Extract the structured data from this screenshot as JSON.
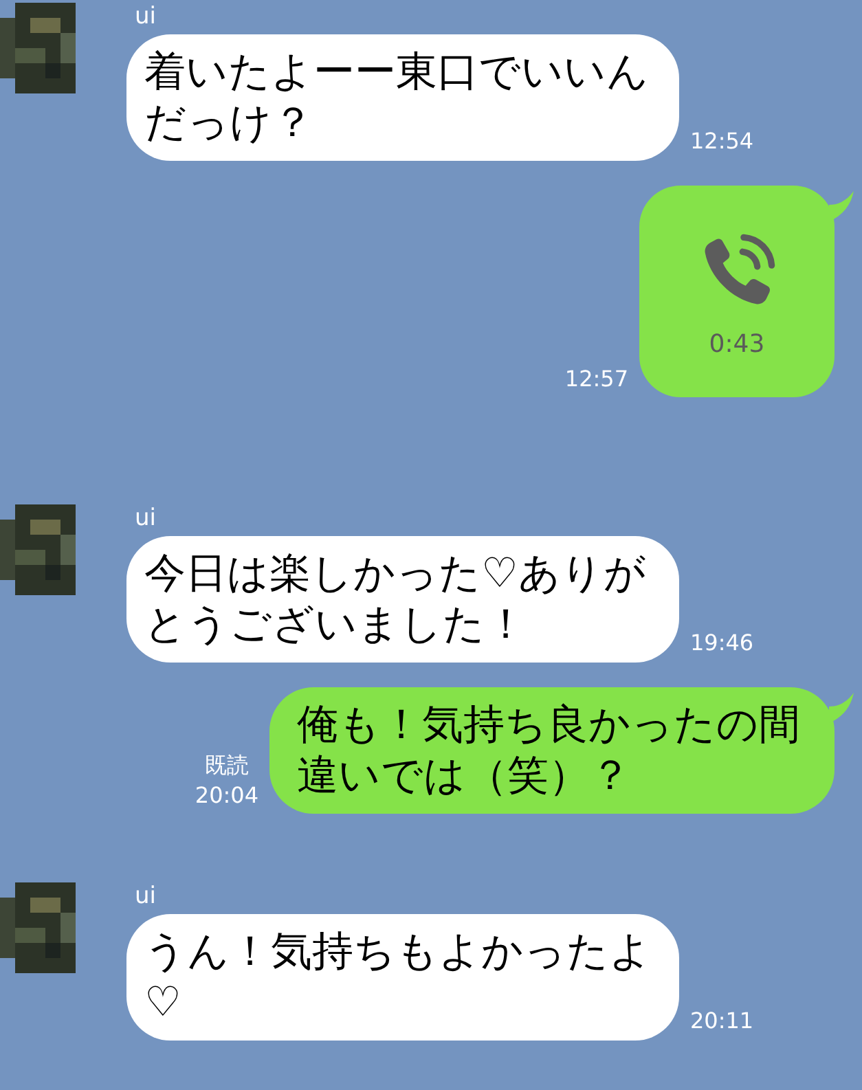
{
  "messages": [
    {
      "kind": "received",
      "sender": "ui",
      "text": "着いたよーー東口でいいんだっけ？",
      "time": "12:54"
    },
    {
      "kind": "call",
      "duration": "0:43",
      "time": "12:57"
    },
    {
      "kind": "received",
      "sender": "ui",
      "text": "今日は楽しかった♡ありがとうございました！",
      "time": "19:46"
    },
    {
      "kind": "sent",
      "read": "既読",
      "text": "俺も！気持ち良かったの間違いでは（笑）？",
      "time": "20:04"
    },
    {
      "kind": "received",
      "sender": "ui",
      "text": "うん！気持ちもよかったよ♡",
      "time": "20:11"
    }
  ]
}
